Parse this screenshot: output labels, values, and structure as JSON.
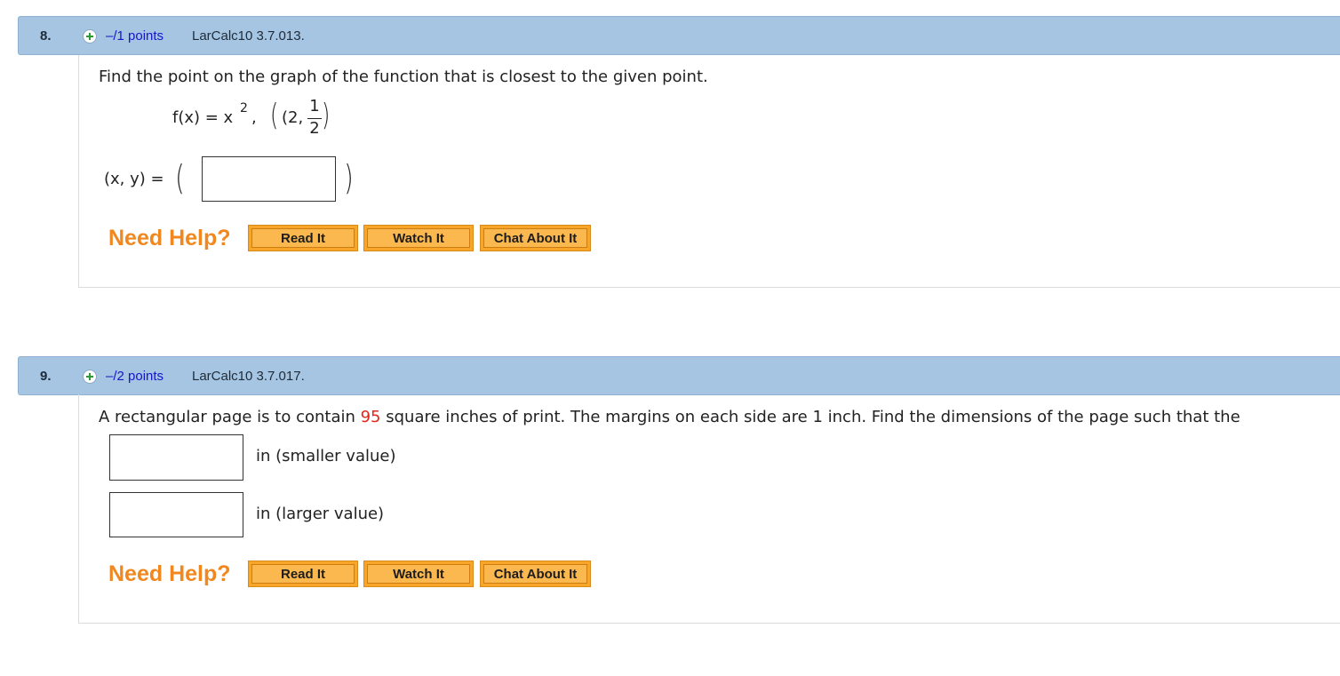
{
  "questions": [
    {
      "number": "8.",
      "points": "–/1 points",
      "source": "LarCalc10 3.7.013.",
      "prompt": "Find the point on the graph of the function that is closest to the given point.",
      "function_label": "f(x) = x",
      "exponent": "2",
      "comma": ",",
      "point_open": "(2,",
      "frac_num": "1",
      "frac_den": "2",
      "answer_label": "(x, y) =",
      "need_help": "Need Help?",
      "buttons": [
        "Read It",
        "Watch It",
        "Chat About It"
      ]
    },
    {
      "number": "9.",
      "points": "–/2 points",
      "source": "LarCalc10 3.7.017.",
      "prompt_before": "A rectangular page is to contain ",
      "prompt_highlight": "95",
      "prompt_after": " square inches of print. The margins on each side are 1 inch. Find the dimensions of the page such that the",
      "answer_smaller": "in (smaller value)",
      "answer_larger": "in (larger value)",
      "need_help": "Need Help?",
      "buttons": [
        "Read It",
        "Watch It",
        "Chat About It"
      ]
    }
  ],
  "colors": {
    "header_bg": "#a5c5e2",
    "points_link": "#1515c9",
    "need_help": "#f0871f",
    "highlight_value": "#e1261c",
    "button_bg": "#f8a62a"
  }
}
